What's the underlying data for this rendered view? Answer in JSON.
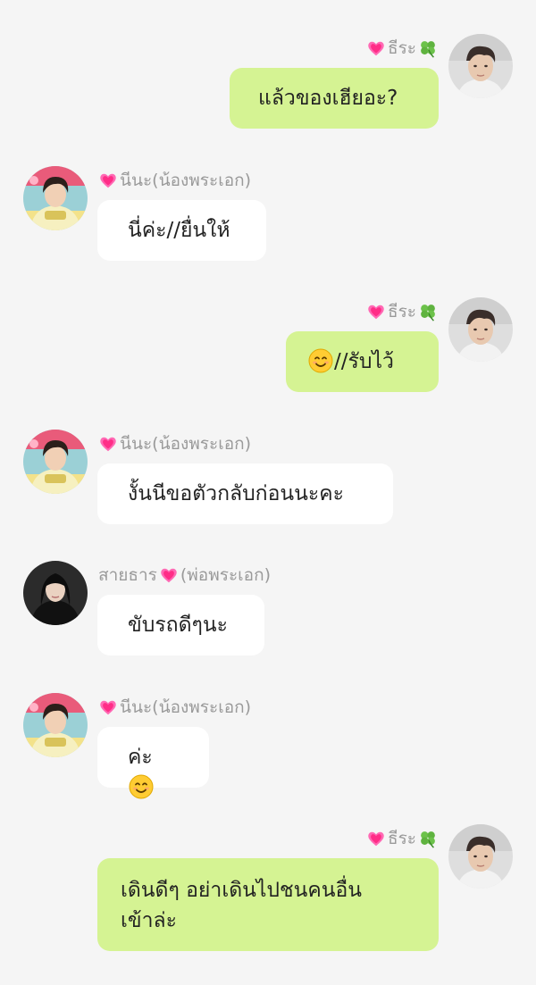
{
  "colors": {
    "background": "#f5f5f5",
    "sent_bubble": "#d5f393",
    "received_bubble": "#ffffff",
    "name_text": "#9a9a9a",
    "heart": "#ff5fa2",
    "clover": "#5cb85c"
  },
  "icons": {
    "heart": "two-hearts-icon",
    "clover": "four-leaf-clover-icon",
    "smile": "smiling-face-emoji-icon"
  },
  "messages": [
    {
      "side": "right",
      "sender": "ธีระ",
      "text": "แล้วของเฮียอะ?"
    },
    {
      "side": "left",
      "sender": "นีนะ(น้องพระเอก)",
      "text": "นี่ค่ะ//ยื่นให้"
    },
    {
      "side": "right",
      "sender": "ธีระ",
      "text": "//รับไว้"
    },
    {
      "side": "left",
      "sender": "นีนะ(น้องพระเอก)",
      "text": "งั้นนีขอตัวกลับก่อนนะคะ"
    },
    {
      "side": "left",
      "sender_prefix": "สายธาร",
      "sender_suffix": "(พ่อพระเอก)",
      "text": "ขับรถดีๆนะ"
    },
    {
      "side": "left",
      "sender": "นีนะ(น้องพระเอก)",
      "text": "ค่ะ"
    },
    {
      "side": "right",
      "sender": "ธีระ",
      "text_line1": "เดินดีๆ อย่าเดินไปชนคนอื่น",
      "text_line2": "เข้าล่ะ"
    }
  ]
}
